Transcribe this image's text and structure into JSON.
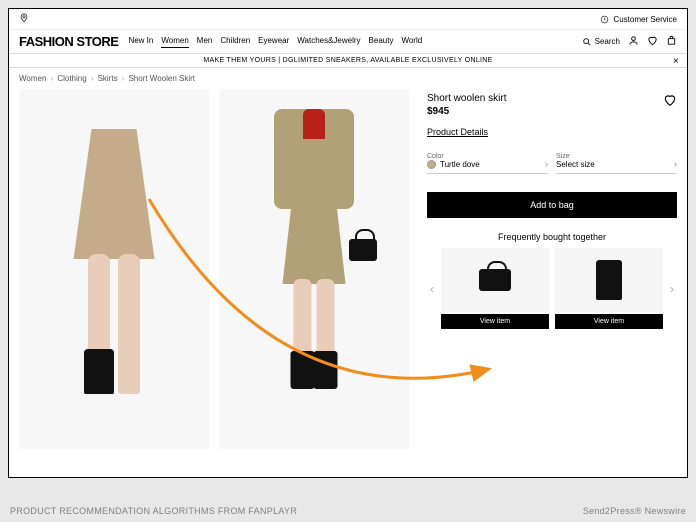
{
  "topbar": {
    "customer_service": "Customer Service"
  },
  "logo": "FASHION STORE",
  "nav": {
    "items": [
      "New In",
      "Women",
      "Men",
      "Children",
      "Eyewear",
      "Watches&Jewelry",
      "Beauty",
      "World"
    ],
    "active_index": 1,
    "search_label": "Search"
  },
  "promo": {
    "text": "MAKE THEM YOURS | DGLIMITED SNEAKERS, AVAILABLE EXCLUSIVELY ONLINE"
  },
  "breadcrumb": [
    "Women",
    "Clothing",
    "Skirts",
    "Short Woolen Skirt"
  ],
  "product": {
    "title": "Short woolen skirt",
    "price": "$945",
    "details_link": "Product Details",
    "color_label": "Color",
    "color_value": "Turtle dove",
    "size_label": "Size",
    "size_value": "Select size",
    "add_to_bag": "Add to bag"
  },
  "recommendations": {
    "title": "Frequently bought together",
    "items": [
      {
        "name": "handbag",
        "btn": "View item"
      },
      {
        "name": "boots",
        "btn": "View item"
      }
    ]
  },
  "caption": {
    "left": "PRODUCT RECOMMENDATION ALGORITHMS FROM FANPLAYR",
    "right": "Send2Press® Newswire"
  },
  "colors": {
    "arrow": "#f28c1a"
  }
}
